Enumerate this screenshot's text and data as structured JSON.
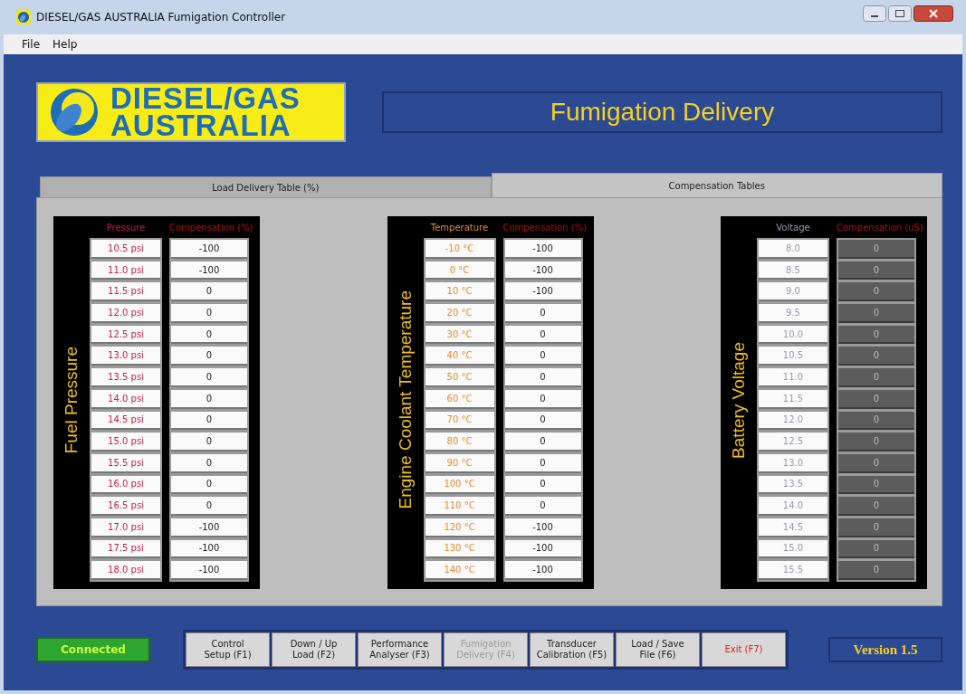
{
  "window": {
    "title": "DIESEL/GAS AUSTRALIA Fumigation Controller"
  },
  "menu": [
    "File",
    "Help"
  ],
  "logo": {
    "line_1": "DIESEL/GAS",
    "line_2": "AUSTRALIA"
  },
  "heading": "Fumigation Delivery",
  "tabs": [
    {
      "label": "Load Delivery Table (%)",
      "selected": false
    },
    {
      "label": "Compensation Tables",
      "selected": true
    }
  ],
  "tables": [
    {
      "title": "Fuel Pressure",
      "key_header": "Pressure",
      "value_header": "Compensation (%)",
      "color": "#c0204a",
      "values_disabled": false,
      "rows": [
        {
          "key": "10.5 psi",
          "value": "-100"
        },
        {
          "key": "11.0 psi",
          "value": "-100"
        },
        {
          "key": "11.5 psi",
          "value": "0"
        },
        {
          "key": "12.0 psi",
          "value": "0"
        },
        {
          "key": "12.5 psi",
          "value": "0"
        },
        {
          "key": "13.0 psi",
          "value": "0"
        },
        {
          "key": "13.5 psi",
          "value": "0"
        },
        {
          "key": "14.0 psi",
          "value": "0"
        },
        {
          "key": "14.5 psi",
          "value": "0"
        },
        {
          "key": "15.0 psi",
          "value": "0"
        },
        {
          "key": "15.5 psi",
          "value": "0"
        },
        {
          "key": "16.0 psi",
          "value": "0"
        },
        {
          "key": "16.5 psi",
          "value": "0"
        },
        {
          "key": "17.0 psi",
          "value": "-100"
        },
        {
          "key": "17.5 psi",
          "value": "-100"
        },
        {
          "key": "18.0 psi",
          "value": "-100"
        }
      ]
    },
    {
      "title": "Engine Coolant Temperature",
      "key_header": "Temperature",
      "value_header": "Compensation (%)",
      "color": "#e08a30",
      "values_disabled": false,
      "rows": [
        {
          "key": "-10 °C",
          "value": "-100"
        },
        {
          "key": "0 °C",
          "value": "-100"
        },
        {
          "key": "10 °C",
          "value": "-100"
        },
        {
          "key": "20 °C",
          "value": "0"
        },
        {
          "key": "30 °C",
          "value": "0"
        },
        {
          "key": "40 °C",
          "value": "0"
        },
        {
          "key": "50 °C",
          "value": "0"
        },
        {
          "key": "60 °C",
          "value": "0"
        },
        {
          "key": "70 °C",
          "value": "0"
        },
        {
          "key": "80 °C",
          "value": "0"
        },
        {
          "key": "90 °C",
          "value": "0"
        },
        {
          "key": "100 °C",
          "value": "0"
        },
        {
          "key": "110 °C",
          "value": "0"
        },
        {
          "key": "120 °C",
          "value": "-100"
        },
        {
          "key": "130 °C",
          "value": "-100"
        },
        {
          "key": "140 °C",
          "value": "-100"
        }
      ]
    },
    {
      "title": "Battery Voltage",
      "key_header": "Voltage",
      "value_header": "Compensation (uS)",
      "color": "#9a9aa8",
      "values_disabled": true,
      "rows": [
        {
          "key": "8.0",
          "value": "0"
        },
        {
          "key": "8.5",
          "value": "0"
        },
        {
          "key": "9.0",
          "value": "0"
        },
        {
          "key": "9.5",
          "value": "0"
        },
        {
          "key": "10.0",
          "value": "0"
        },
        {
          "key": "10.5",
          "value": "0"
        },
        {
          "key": "11.0",
          "value": "0"
        },
        {
          "key": "11.5",
          "value": "0"
        },
        {
          "key": "12.0",
          "value": "0"
        },
        {
          "key": "12.5",
          "value": "0"
        },
        {
          "key": "13.0",
          "value": "0"
        },
        {
          "key": "13.5",
          "value": "0"
        },
        {
          "key": "14.0",
          "value": "0"
        },
        {
          "key": "14.5",
          "value": "0"
        },
        {
          "key": "15.0",
          "value": "0"
        },
        {
          "key": "15.5",
          "value": "0"
        }
      ]
    }
  ],
  "status": "Connected",
  "buttons": [
    {
      "line_1": "Control",
      "line_2": "Setup (F1)",
      "kind": "normal",
      "disabled": false
    },
    {
      "line_1": "Down / Up",
      "line_2": "Load (F2)",
      "kind": "normal",
      "disabled": false
    },
    {
      "line_1": "Performance",
      "line_2": "Analyser (F3)",
      "kind": "normal",
      "disabled": false
    },
    {
      "line_1": "Fumigation",
      "line_2": "Delivery (F4)",
      "kind": "normal",
      "disabled": true
    },
    {
      "line_1": "Transducer",
      "line_2": "Calibration (F5)",
      "kind": "normal",
      "disabled": false
    },
    {
      "line_1": "Load / Save",
      "line_2": "File (F6)",
      "kind": "normal",
      "disabled": false
    },
    {
      "line_1": "Exit (F7)",
      "kind": "exit",
      "disabled": false
    }
  ],
  "version": "Version 1.5"
}
